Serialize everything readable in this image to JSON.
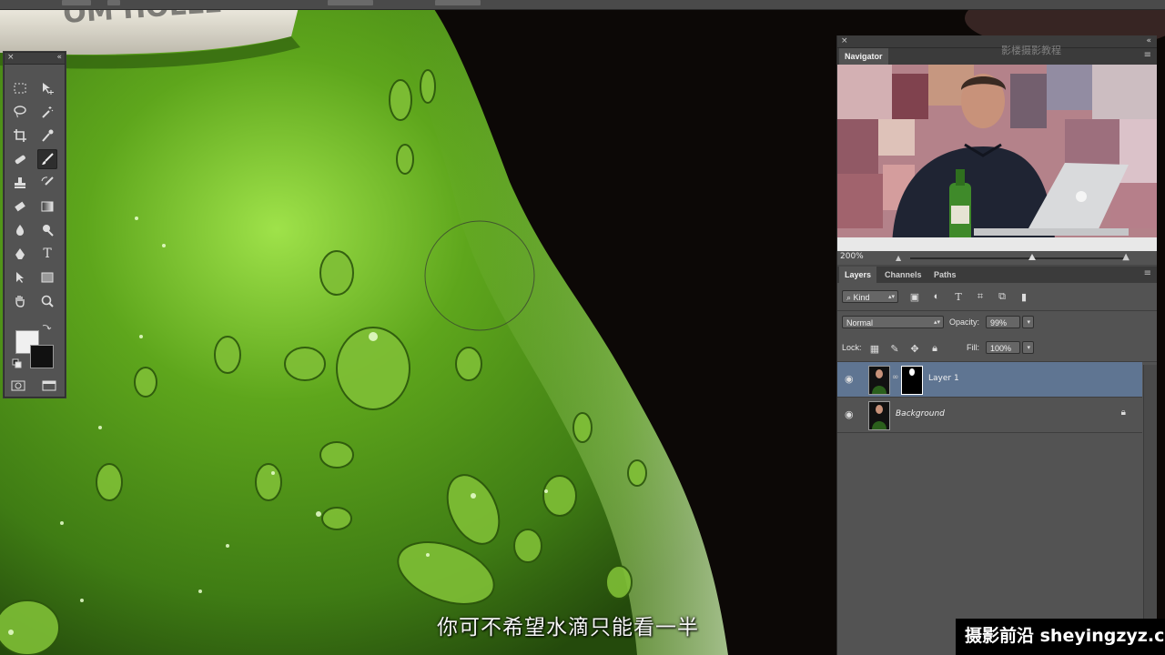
{
  "tools_panel": {
    "close_glyph": "×",
    "collapse_glyph": "«",
    "tools": [
      {
        "name": "marquee-tool-icon"
      },
      {
        "name": "move-tool-icon"
      },
      {
        "name": "lasso-tool-icon"
      },
      {
        "name": "magic-wand-tool-icon"
      },
      {
        "name": "crop-tool-icon"
      },
      {
        "name": "eyedropper-tool-icon"
      },
      {
        "name": "spot-healing-tool-icon"
      },
      {
        "name": "brush-tool-icon"
      },
      {
        "name": "clone-stamp-tool-icon"
      },
      {
        "name": "history-brush-tool-icon"
      },
      {
        "name": "eraser-tool-icon"
      },
      {
        "name": "gradient-tool-icon"
      },
      {
        "name": "blur-tool-icon"
      },
      {
        "name": "dodge-tool-icon"
      },
      {
        "name": "pen-tool-icon"
      },
      {
        "name": "type-tool-icon",
        "glyph": "T"
      },
      {
        "name": "path-selection-tool-icon"
      },
      {
        "name": "rectangle-tool-icon"
      },
      {
        "name": "hand-tool-icon"
      },
      {
        "name": "zoom-tool-icon"
      }
    ],
    "active_tool": "brush-tool-icon",
    "foreground_color": "#f0f0f0",
    "background_color": "#111111"
  },
  "navigator": {
    "title": "Navigator",
    "zoom": "200%",
    "watermark": "影楼摄影教程"
  },
  "layers_panel": {
    "tabs": [
      "Layers",
      "Channels",
      "Paths"
    ],
    "active_tab": "Layers",
    "filter_kind": "Kind",
    "blend_mode": "Normal",
    "opacity_label": "Opacity:",
    "opacity_value": "99%",
    "lock_label": "Lock:",
    "fill_label": "Fill:",
    "fill_value": "100%",
    "layers": [
      {
        "name": "Layer 1",
        "selected": true,
        "has_mask": true,
        "italic": false
      },
      {
        "name": "Background",
        "selected": false,
        "has_mask": false,
        "italic": true,
        "locked": true
      }
    ]
  },
  "subtitle": "你可不希望水滴只能看一半",
  "watermark": "摄影前沿 sheyingzyz.com",
  "colors": {
    "bottle_green": "#4e9a1a",
    "bottle_highlight": "#9edb4a",
    "selected_layer": "#5f7592",
    "panel_bg": "#535353"
  }
}
